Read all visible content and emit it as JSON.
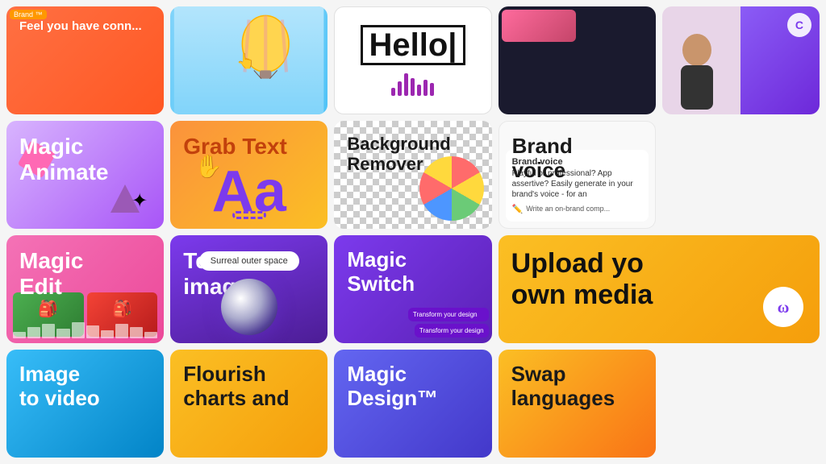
{
  "cards": {
    "row1": {
      "c1": {
        "title": "Feel you have conn..."
      },
      "c2": {
        "label": "hot-air-balloon card"
      },
      "c3": {
        "hello": "Hello|",
        "label": "hello-wave-card"
      },
      "c4": {
        "label": "colorful-portrait-card"
      },
      "c5": {
        "label": "person-purple-card"
      }
    },
    "row2": {
      "c6": {
        "title": "Magic\nAnimate"
      },
      "c7": {
        "title": "Grab Text"
      },
      "c8": {
        "title": "Background\nRemover"
      },
      "c9": {
        "title": "Brand\nvoice",
        "body": "Brand voice",
        "description": "Playful or professional? App assertive? Easily generate in your brand's voice - for an",
        "cta": "Write an on-brand comp..."
      }
    },
    "row3": {
      "c10": {
        "title": "Magic\nEdit"
      },
      "c11": {
        "title": "Text to image",
        "prompt": "Surreal outer space"
      },
      "c12": {
        "title": "Magic\nSwitch",
        "transform1": "Transform your design",
        "transform2": "Transform your design"
      },
      "c13": {
        "title": "Upload yo\nown media"
      }
    },
    "row4": {
      "c14": {
        "title": "Image\nto video"
      },
      "c15": {
        "title": "Flourish\ncharts and"
      },
      "c16": {
        "title": "Magic\nDesign™"
      },
      "c17": {
        "title": "Swap\nlanguages"
      }
    }
  },
  "colors": {
    "magicAnimate": "#c084fc",
    "grabText": "#fb923c",
    "magicEdit": "#f472b6",
    "textToImage": "#7c3aed",
    "magicSwitch": "#6d28d9",
    "uploadMedia": "#f59e0b",
    "imageToVideo": "#0ea5e9",
    "flourish": "#f59e0b",
    "magicDesign": "#4f46e5",
    "swapLang": "#f59e0b"
  }
}
